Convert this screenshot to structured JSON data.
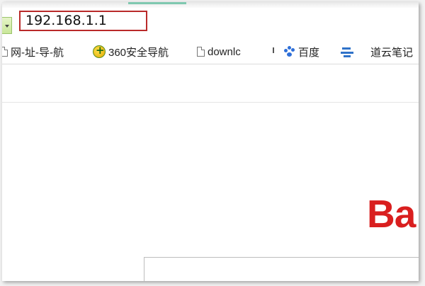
{
  "address_bar": {
    "url": "192.168.1.1"
  },
  "bookmarks": [
    {
      "label": "网-址-导-航",
      "icon": "page-icon"
    },
    {
      "label": "360安全导航",
      "icon": "360-shield-icon"
    },
    {
      "label": "downlc",
      "icon": "page-icon"
    },
    {
      "label": "百度",
      "icon": "baidu-paw-icon"
    },
    {
      "label": "道云笔记",
      "icon": "cloud-icon"
    }
  ],
  "page": {
    "logo_text": "Ba"
  },
  "colors": {
    "url_highlight": "#b92a2a",
    "baidu_red": "#d91f1f",
    "dropdown_green": "#c9e79a"
  }
}
